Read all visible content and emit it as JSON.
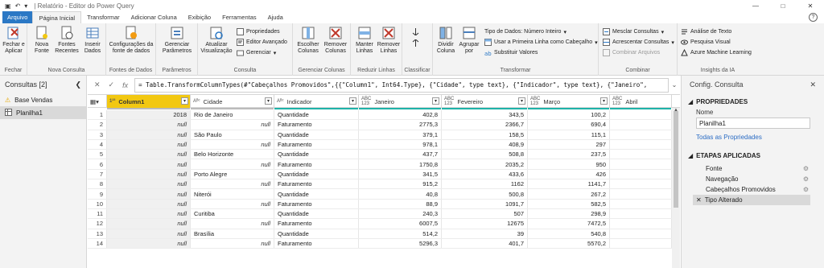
{
  "titlebar": {
    "title": "| Relatório - Editor do Power Query"
  },
  "tabs": [
    "Arquivo",
    "Página Inicial",
    "Transformar",
    "Adicionar Coluna",
    "Exibição",
    "Ferramentas",
    "Ajuda"
  ],
  "ribbon": {
    "fechar": {
      "btn": "Fechar e\nAplicar",
      "group": "Fechar"
    },
    "nova_consulta": {
      "btns": [
        "Nova\nFonte",
        "Fontes\nRecentes",
        "Inserir\nDados"
      ],
      "group": "Nova Consulta"
    },
    "fontes": {
      "btn": "Configurações da\nfonte de dados",
      "group": "Fontes de Dados"
    },
    "parametros": {
      "btn": "Gerenciar\nParâmetros",
      "group": "Parâmetros"
    },
    "consulta": {
      "big": "Atualizar\nVisualização",
      "small": [
        "Propriedades",
        "Editor Avançado",
        "Gerenciar"
      ],
      "group": "Consulta"
    },
    "colunas": {
      "btns": [
        "Escolher\nColunas",
        "Remover\nColunas"
      ],
      "group": "Gerenciar Colunas"
    },
    "linhas": {
      "btns": [
        "Manter\nLinhas",
        "Remover\nLinhas"
      ],
      "group": "Reduzir Linhas"
    },
    "classificar": {
      "group": "Classificar"
    },
    "transformar": {
      "big": [
        "Dividir\nColuna",
        "Agrupar\npor"
      ],
      "small": [
        "Tipo de Dados: Número Inteiro",
        "Usar a Primeira Linha como Cabeçalho",
        "Substituir Valores"
      ],
      "group": "Transformar"
    },
    "combinar": {
      "small": [
        "Mesclar Consultas",
        "Acrescentar Consultas",
        "Combinar Arquivos"
      ],
      "group": "Combinar"
    },
    "ia": {
      "small": [
        "Análise de Texto",
        "Pesquisa Visual",
        "Azure Machine Learning"
      ],
      "group": "Insights da IA"
    }
  },
  "leftpane": {
    "title": "Consultas [2]",
    "items": [
      "Base Vendas",
      "Planilha1"
    ]
  },
  "formula": {
    "text": "= Table.TransformColumnTypes(#\"Cabeçalhos Promovidos\",{{\"Column1\", Int64.Type}, {\"Cidade\", type text}, {\"Indicador\", type text}, {\"Janeiro\","
  },
  "grid": {
    "headers": [
      {
        "type": "1²³",
        "name": "Column1"
      },
      {
        "type": "Aᴮᶜ",
        "name": "Cidade"
      },
      {
        "type": "Aᴮᶜ",
        "name": "Indicador"
      },
      {
        "type": "ABC\n123",
        "name": "Janeiro"
      },
      {
        "type": "ABC\n123",
        "name": "Fevereiro"
      },
      {
        "type": "ABC\n123",
        "name": "Março"
      },
      {
        "type": "ABC\n123",
        "name": "Abril"
      }
    ],
    "rows": [
      [
        "1",
        "2018",
        "Rio de Janeiro",
        "Quantidade",
        "402,8",
        "343,5",
        "100,2"
      ],
      [
        "2",
        "null",
        "null",
        "Faturamento",
        "2775,3",
        "2366,7",
        "690,4"
      ],
      [
        "3",
        "null",
        "São Paulo",
        "Quantidade",
        "379,1",
        "158,5",
        "115,1"
      ],
      [
        "4",
        "null",
        "null",
        "Faturamento",
        "978,1",
        "408,9",
        "297"
      ],
      [
        "5",
        "null",
        "Belo Horizonte",
        "Quantidade",
        "437,7",
        "508,8",
        "237,5"
      ],
      [
        "6",
        "null",
        "null",
        "Faturamento",
        "1750,8",
        "2035,2",
        "950"
      ],
      [
        "7",
        "null",
        "Porto Alegre",
        "Quantidade",
        "341,5",
        "433,6",
        "426"
      ],
      [
        "8",
        "null",
        "null",
        "Faturamento",
        "915,2",
        "1162",
        "1141,7"
      ],
      [
        "9",
        "null",
        "Niterói",
        "Quantidade",
        "40,8",
        "500,8",
        "267,2"
      ],
      [
        "10",
        "null",
        "null",
        "Faturamento",
        "88,9",
        "1091,7",
        "582,5"
      ],
      [
        "11",
        "null",
        "Curitiba",
        "Quantidade",
        "240,3",
        "507",
        "298,9"
      ],
      [
        "12",
        "null",
        "null",
        "Faturamento",
        "6007,5",
        "12675",
        "7472,5"
      ],
      [
        "13",
        "null",
        "Brasília",
        "Quantidade",
        "514,2",
        "39",
        "540,8"
      ],
      [
        "14",
        "null",
        "null",
        "Faturamento",
        "5296,3",
        "401,7",
        "5570,2"
      ]
    ]
  },
  "rightpane": {
    "title": "Config. Consulta",
    "props_title": "PROPRIEDADES",
    "name_label": "Nome",
    "name_value": "Planilha1",
    "all_props": "Todas as Propriedades",
    "steps_title": "ETAPAS APLICADAS",
    "steps": [
      "Fonte",
      "Navegação",
      "Cabeçalhos Promovidos",
      "Tipo Alterado"
    ]
  },
  "colors": {
    "accent": "#2b78c5",
    "selected_col": "#f2c811",
    "quality": "#1fb3a9"
  }
}
